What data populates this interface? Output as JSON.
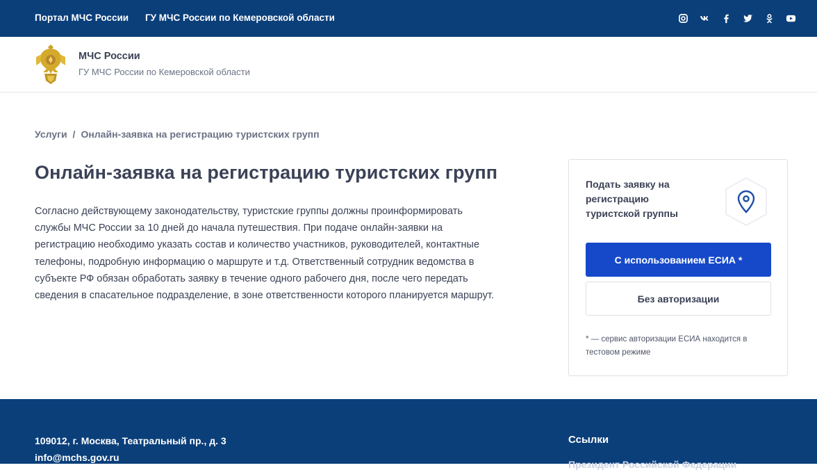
{
  "topbar": {
    "links": [
      "Портал МЧС России",
      "ГУ МЧС России по Кемеровской области"
    ],
    "socials": [
      "instagram-icon",
      "vk-icon",
      "facebook-icon",
      "twitter-icon",
      "odnoklassniki-icon",
      "youtube-icon"
    ]
  },
  "header": {
    "org_name": "МЧС России",
    "org_sub": "ГУ МЧС России по Кемеровской области"
  },
  "breadcrumb": {
    "root": "Услуги",
    "separator": "/",
    "current": "Онлайн-заявка на регистрацию туристских групп"
  },
  "main": {
    "title": "Онлайн-заявка на регистрацию туристских групп",
    "description": [
      "Согласно действующему законодательству, туристские группы должны проинформировать",
      "службы МЧС России за 10 дней до начала путешествия. При подаче онлайн-заявки на",
      "регистрацию необходимо указать состав и количество участников, руководителей, контактные",
      "телефоны, подробную информацию о маршруте и т.д. Ответственный сотрудник ведомства в",
      "субъекте РФ обязан обработать заявку в течение одного рабочего дня, после чего передать",
      "сведения в спасательное подразделение, в зоне ответственности которого планируется маршрут."
    ]
  },
  "card": {
    "title": "Подать заявку на регистрацию туристской группы",
    "esia_button": "С использованием ЕСИА *",
    "noauth_button": "Без авторизации",
    "note": "* — сервис авторизации ЕСИА находится в тестовом режиме"
  },
  "footer": {
    "address": "109012, г. Москва, Театральный пр., д. 3",
    "email": "info@mchs.gov.ru",
    "links_title": "Ссылки",
    "first_link": "Президент Российской Федерации"
  },
  "colors": {
    "brand_blue": "#0b3f7a",
    "button_blue": "#1549c9",
    "text": "#3b4256"
  }
}
